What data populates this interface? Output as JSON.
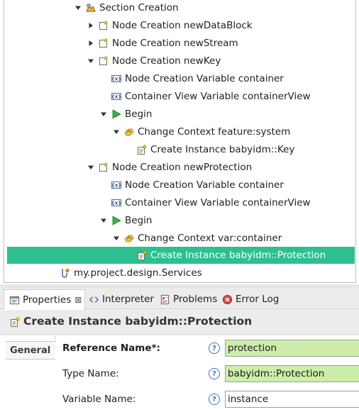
{
  "tree": {
    "rows": [
      {
        "label": "Section Creation",
        "icon": "section-icon",
        "expanded": true
      },
      {
        "label": "Node Creation newDataBlock",
        "icon": "node-creation-icon",
        "expanded": false
      },
      {
        "label": "Node Creation newStream",
        "icon": "node-creation-icon",
        "expanded": false
      },
      {
        "label": "Node Creation newKey",
        "icon": "node-creation-icon",
        "expanded": true
      },
      {
        "label": "Node Creation Variable container",
        "icon": "variable-icon"
      },
      {
        "label": "Container View Variable containerView",
        "icon": "variable-icon"
      },
      {
        "label": "Begin",
        "icon": "begin-icon",
        "expanded": true
      },
      {
        "label": "Change Context feature:system",
        "icon": "change-context-icon",
        "expanded": true
      },
      {
        "label": "Create Instance babyidm::Key",
        "icon": "create-instance-icon"
      },
      {
        "label": "Node Creation newProtection",
        "icon": "node-creation-icon",
        "expanded": true
      },
      {
        "label": "Node Creation Variable container",
        "icon": "variable-icon"
      },
      {
        "label": "Container View Variable containerView",
        "icon": "variable-icon"
      },
      {
        "label": "Begin",
        "icon": "begin-icon",
        "expanded": true
      },
      {
        "label": "Change Context var:container",
        "icon": "change-context-icon",
        "expanded": true
      },
      {
        "label": "Create Instance babyidm::Protection",
        "icon": "create-instance-icon",
        "selected": true
      },
      {
        "label": "my.project.design.Services",
        "icon": "java-services-icon"
      }
    ],
    "selection_color": "#2ebf91"
  },
  "views": {
    "tabs": [
      {
        "label": "Properties",
        "icon": "properties-icon",
        "active": true
      },
      {
        "label": "Interpreter",
        "icon": "interpreter-icon"
      },
      {
        "label": "Problems",
        "icon": "problems-icon"
      },
      {
        "label": "Error Log",
        "icon": "error-log-icon"
      }
    ]
  },
  "properties": {
    "title": "Create Instance babyidm::Protection",
    "side_tab": "General",
    "fields": [
      {
        "label": "Reference Name*:",
        "value": "protection",
        "required": true
      },
      {
        "label": "Type Name:",
        "value": "babyidm::Protection"
      },
      {
        "label": "Variable Name:",
        "value": "instance"
      }
    ],
    "help_glyph": "?",
    "valid_field_color": "#cdeeaa"
  }
}
